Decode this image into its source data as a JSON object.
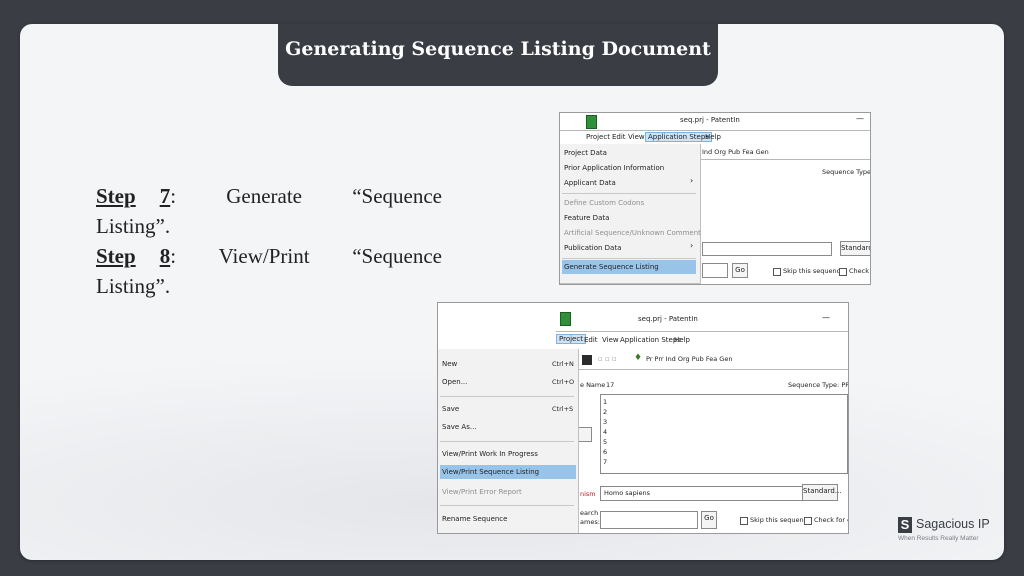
{
  "slide": {
    "title": "Generating Sequence Listing Document",
    "steps": [
      {
        "label": "Step",
        "num": "7",
        "text_parts": [
          "Generate",
          "“Sequence"
        ],
        "continuation": "Listing”."
      },
      {
        "label": "Step",
        "num": "8",
        "text_parts": [
          "View/Print",
          "“Sequence"
        ],
        "continuation": "Listing”."
      }
    ]
  },
  "shot1": {
    "window_title": "seq.prj - PatentIn",
    "menubar": [
      "Project",
      "Edit",
      "View",
      "Application Steps",
      "Help"
    ],
    "toolbar_tail": "Ind Org Pub Fea Gen",
    "sequence_type_label": "Sequence Type: P",
    "menu_items": [
      "Project Data",
      "Prior Application Information",
      "Applicant Data",
      "Define Custom Codons",
      "Feature Data",
      "Artificial Sequence/Unknown Comment",
      "Publication Data",
      "Generate Sequence Listing"
    ],
    "submenu_arrow": "›",
    "standard_button": "Standard...",
    "go_button": "Go",
    "skip_label": "Skip this sequence",
    "check_label": "Check fo",
    "minimize": "—"
  },
  "shot2": {
    "window_title": "seq.prj - PatentIn",
    "menubar": [
      "Project",
      "Edit",
      "View",
      "Application Steps",
      "Help"
    ],
    "toolbar_text": "Pr Prr Ind Org Pub Fea Gen",
    "seq_name_label": "e Name",
    "seq_name_value": "17",
    "sequence_type_label": "Sequence Type: PRT",
    "line_numbers": [
      "1",
      "2",
      "3",
      "4",
      "5",
      "6",
      "7"
    ],
    "organism_label": "nism",
    "organism_value": "Homo sapiens",
    "standard_button": "Standard...",
    "search_label_1": "earch",
    "search_label_2": "ames:",
    "go_button": "Go",
    "skip_label": "Skip this sequence",
    "check_label": "Check for go",
    "minimize": "—",
    "menu_items": [
      {
        "label": "New",
        "shortcut": "Ctrl+N"
      },
      {
        "label": "Open...",
        "shortcut": "Ctrl+O"
      },
      {
        "label": "Save",
        "shortcut": "Ctrl+S"
      },
      {
        "label": "Save As...",
        "shortcut": ""
      },
      {
        "label": "View/Print Work In Progress",
        "shortcut": ""
      },
      {
        "label": "View/Print Sequence Listing",
        "shortcut": ""
      },
      {
        "label": "View/Print Error Report",
        "shortcut": ""
      },
      {
        "label": "Rename Sequence",
        "shortcut": ""
      }
    ]
  },
  "brand": {
    "mark": "S",
    "name": "Sagacious IP",
    "tagline": "When Results Really Matter"
  }
}
